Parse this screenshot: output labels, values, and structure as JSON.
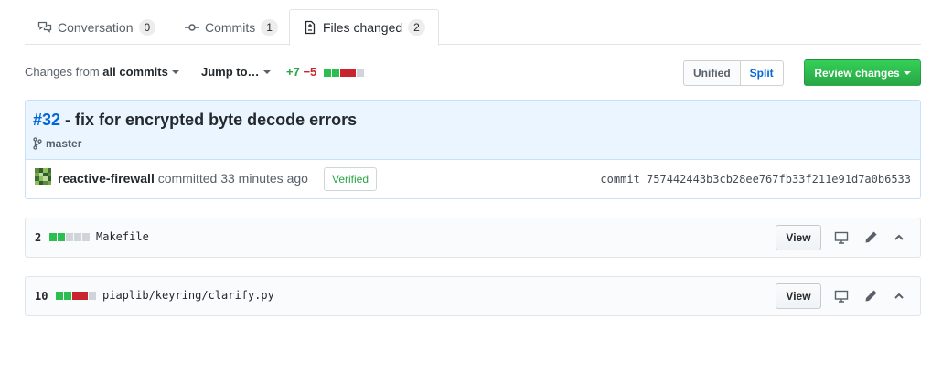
{
  "tabs": [
    {
      "label": "Conversation",
      "count": "0"
    },
    {
      "label": "Commits",
      "count": "1"
    },
    {
      "label": "Files changed",
      "count": "2"
    }
  ],
  "toolbar": {
    "changes_prefix": "Changes from",
    "changes_value": "all commits",
    "jump_to": "Jump to…",
    "additions": "+7",
    "deletions": "−5",
    "diffstat_blocks": [
      "add",
      "add",
      "del",
      "del",
      "neu"
    ],
    "view_unified": "Unified",
    "view_split": "Split",
    "review_button": "Review changes"
  },
  "commit": {
    "number": "#32",
    "title": " - fix for encrypted byte decode errors",
    "branch": "master",
    "author": "reactive-firewall",
    "action": " committed 33 minutes ago",
    "verified": "Verified",
    "sha_label": "commit",
    "sha": "757442443b3cb28ee767fb33f211e91d7a0b6533"
  },
  "files": [
    {
      "count": "2",
      "name": "Makefile",
      "blocks": [
        "add",
        "add",
        "neu",
        "neu",
        "neu"
      ],
      "view_label": "View"
    },
    {
      "count": "10",
      "name": "piaplib/keyring/clarify.py",
      "blocks": [
        "add",
        "add",
        "del",
        "del",
        "neu"
      ],
      "view_label": "View"
    }
  ],
  "colors": {
    "accent": "#0366d6",
    "addition": "#2cbe4e",
    "deletion": "#cb2431",
    "review_button": "#28a745"
  },
  "icons": [
    "comment-discussion-icon",
    "git-commit-icon",
    "file-diff-icon",
    "git-branch-icon",
    "desktop-icon",
    "pencil-icon",
    "chevron-up-icon"
  ]
}
